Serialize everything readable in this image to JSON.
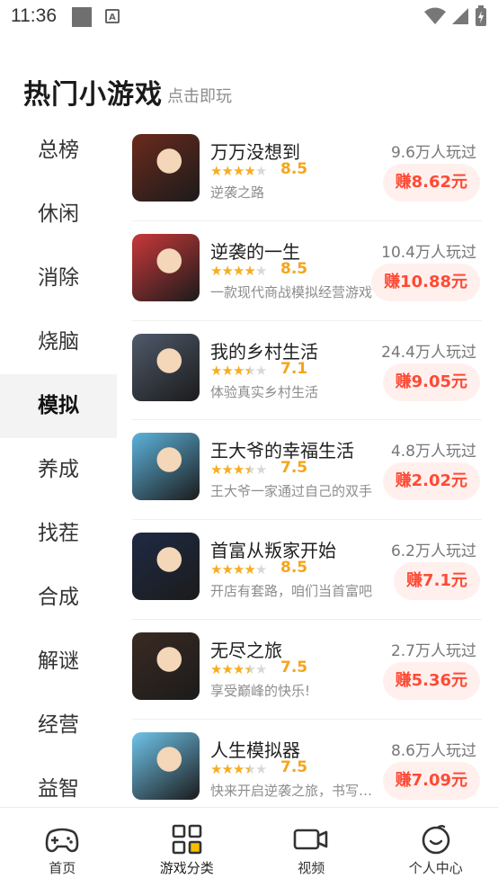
{
  "status": {
    "time": "11:36"
  },
  "header": {
    "title": "热门小游戏",
    "subtitle": "点击即玩"
  },
  "sidebar": {
    "active_index": 4,
    "items": [
      "总榜",
      "休闲",
      "消除",
      "烧脑",
      "模拟",
      "养成",
      "找茬",
      "合成",
      "解谜",
      "经营",
      "益智"
    ]
  },
  "games": [
    {
      "name": "万万没想到",
      "players": "9.6万人玩过",
      "rating": 4,
      "score": "8.5",
      "desc": "逆袭之路",
      "reward": "赚8.62元"
    },
    {
      "name": "逆袭的一生",
      "players": "10.4万人玩过",
      "rating": 4,
      "score": "8.5",
      "desc": "一款现代商战模拟经营游戏",
      "reward": "赚10.88元"
    },
    {
      "name": "我的乡村生活",
      "players": "24.4万人玩过",
      "rating": 3.5,
      "score": "7.1",
      "desc": "体验真实乡村生活",
      "reward": "赚9.05元"
    },
    {
      "name": "王大爷的幸福生活",
      "players": "4.8万人玩过",
      "rating": 3.5,
      "score": "7.5",
      "desc": "王大爷一家通过自己的双手",
      "reward": "赚2.02元"
    },
    {
      "name": "首富从叛家开始",
      "players": "6.2万人玩过",
      "rating": 4,
      "score": "8.5",
      "desc": "开店有套路，咱们当首富吧",
      "reward": "赚7.1元"
    },
    {
      "name": "无尽之旅",
      "players": "2.7万人玩过",
      "rating": 3.5,
      "score": "7.5",
      "desc": "享受巅峰的快乐!",
      "reward": "赚5.36元"
    },
    {
      "name": "人生模拟器",
      "players": "8.6万人玩过",
      "rating": 3.5,
      "score": "7.5",
      "desc": "快来开启逆袭之旅，书写传奇",
      "reward": "赚7.09元"
    }
  ],
  "thumbnail_colors": [
    "#6b2a1c",
    "#c9383a",
    "#4f5a6b",
    "#5cb3dc",
    "#1e2a44",
    "#3a2a22",
    "#6fc4ea"
  ],
  "bottom_nav": [
    {
      "label": "首页",
      "icon": "gamepad-icon"
    },
    {
      "label": "游戏分类",
      "icon": "grid-icon"
    },
    {
      "label": "视频",
      "icon": "video-camera-icon"
    },
    {
      "label": "个人中心",
      "icon": "smile-face-icon"
    }
  ],
  "active_nav_index": 1,
  "colors": {
    "reward_text": "#ff4a34",
    "reward_bg": "#fff0ee",
    "star": "#f7ad20",
    "grid_accent": "#f6c000"
  }
}
